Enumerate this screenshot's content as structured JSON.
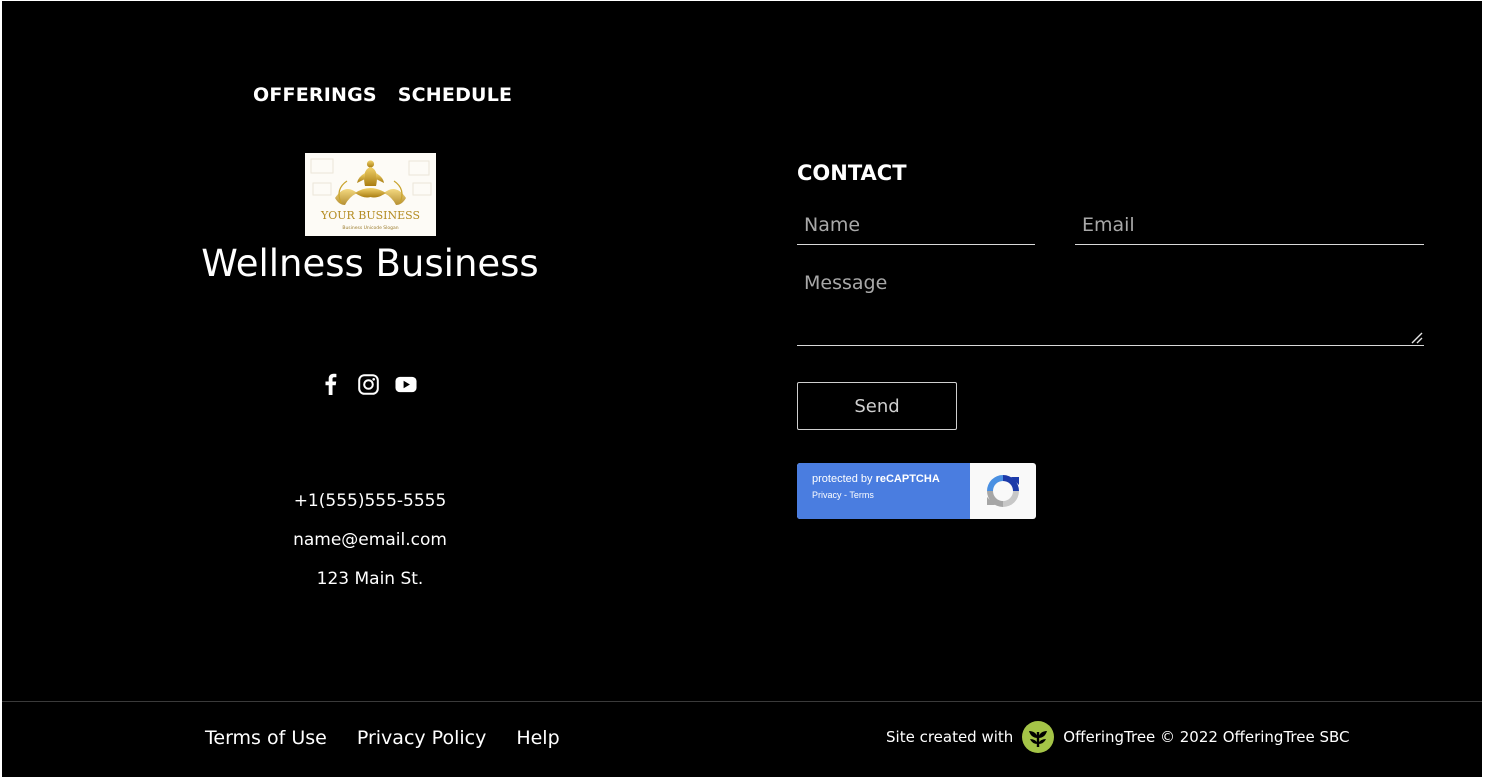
{
  "nav": {
    "items": [
      "OFFERINGS",
      "SCHEDULE"
    ]
  },
  "logo": {
    "text_main": "YOUR BUSINESS",
    "text_sub": "Business Unicode Slogan",
    "icon": "yoga-meditation-logo"
  },
  "brand": {
    "title": "Wellness Business"
  },
  "socials": {
    "icons": [
      "facebook-icon",
      "instagram-icon",
      "youtube-icon"
    ]
  },
  "contact_info": {
    "phone": "+1(555)555-5555",
    "email": "name@email.com",
    "address": "123 Main St."
  },
  "contact_form": {
    "heading": "CONTACT",
    "name_placeholder": "Name",
    "email_placeholder": "Email",
    "message_placeholder": "Message",
    "send_label": "Send"
  },
  "recaptcha": {
    "protected_prefix": "protected by ",
    "protected_brand": "reCAPTCHA",
    "links": "Privacy - Terms",
    "icon": "recaptcha-icon"
  },
  "footer": {
    "links": [
      "Terms of Use",
      "Privacy Policy",
      "Help"
    ],
    "credit_prefix": "Site created with",
    "credit_brand": "OfferingTree",
    "copyright": "© 2022 OfferingTree SBC"
  },
  "colors": {
    "background": "#000000",
    "text": "#ffffff",
    "recaptcha_blue": "#4a7de0",
    "logo_gold": "#c9a32c",
    "offeringtree_green": "#a4c447"
  }
}
